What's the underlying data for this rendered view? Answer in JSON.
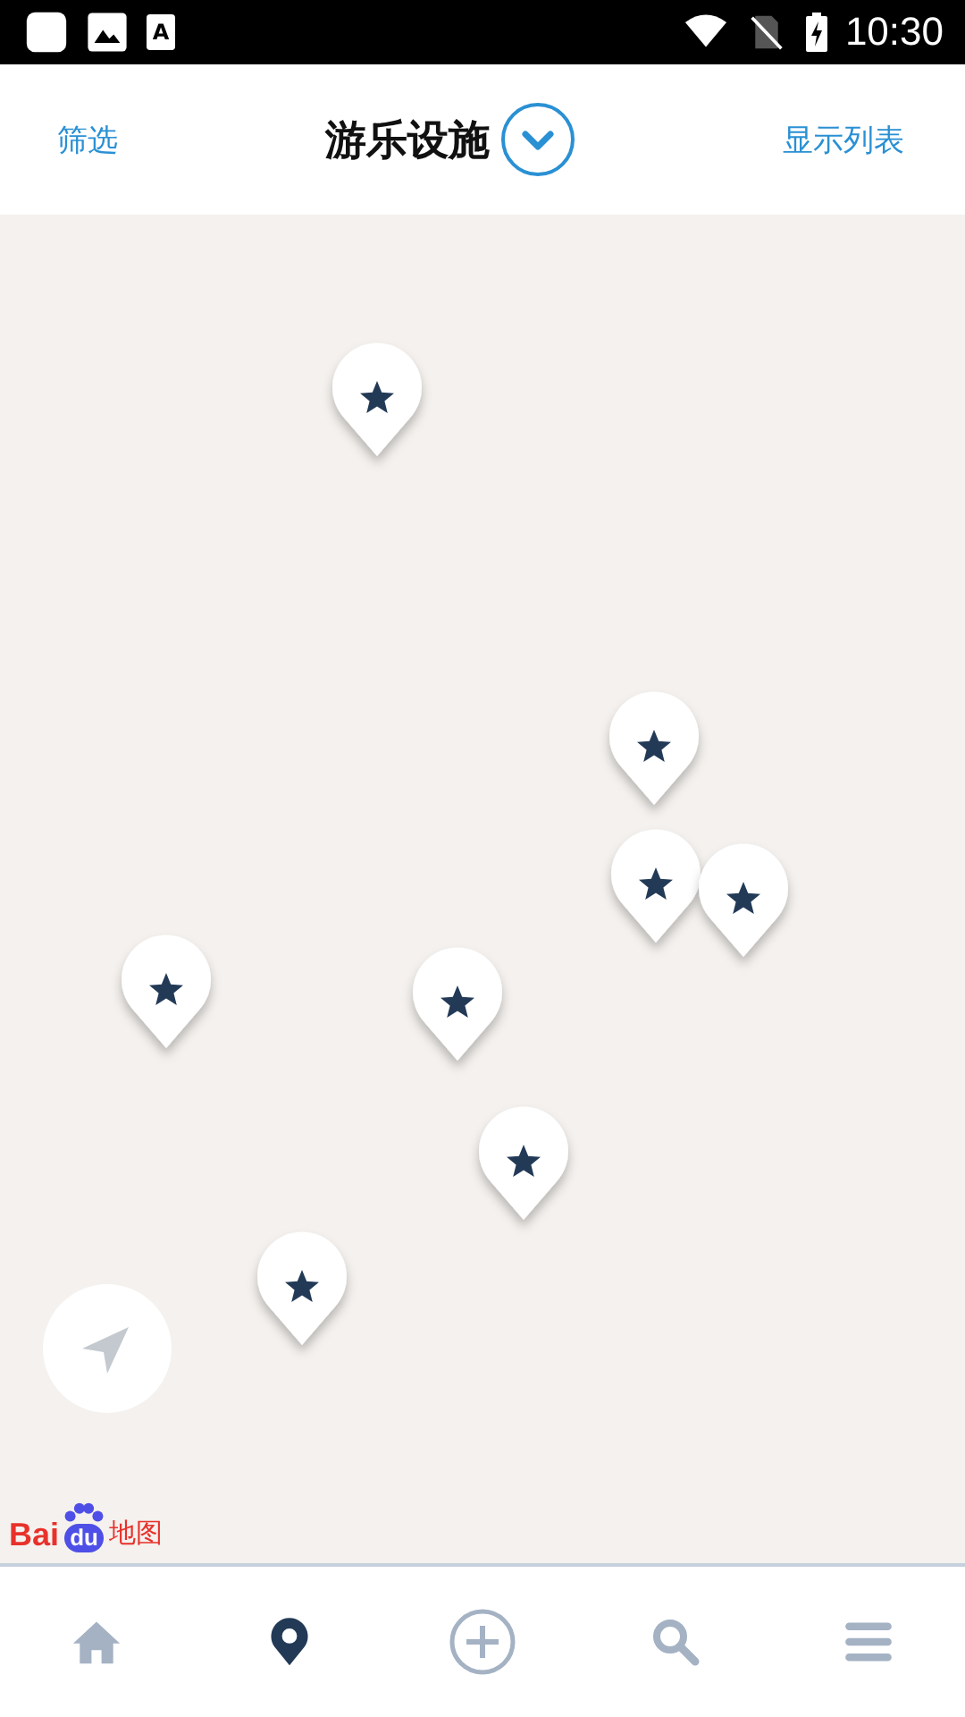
{
  "status_bar": {
    "time": "10:30",
    "battery_charging": true,
    "notifications": [
      {
        "kind": "square"
      },
      {
        "kind": "image"
      },
      {
        "kind": "letter",
        "text": "A"
      }
    ]
  },
  "header": {
    "left_action": "筛选",
    "title": "游乐设施",
    "right_action": "显示列表",
    "dropdown_expanded": false
  },
  "map": {
    "pins": [
      {
        "kind": "star"
      },
      {
        "kind": "star"
      },
      {
        "kind": "star"
      },
      {
        "kind": "star"
      },
      {
        "kind": "star"
      },
      {
        "kind": "star"
      },
      {
        "kind": "star"
      },
      {
        "kind": "star"
      }
    ],
    "logo": {
      "part_1": "Bai",
      "part_2": "du",
      "part_3": "地图"
    }
  },
  "bottom_nav": [
    {
      "kind": "home",
      "selected": false
    },
    {
      "kind": "location",
      "selected": true
    },
    {
      "kind": "add",
      "selected": false
    },
    {
      "kind": "search",
      "selected": false
    },
    {
      "kind": "menu",
      "selected": false
    }
  ]
}
